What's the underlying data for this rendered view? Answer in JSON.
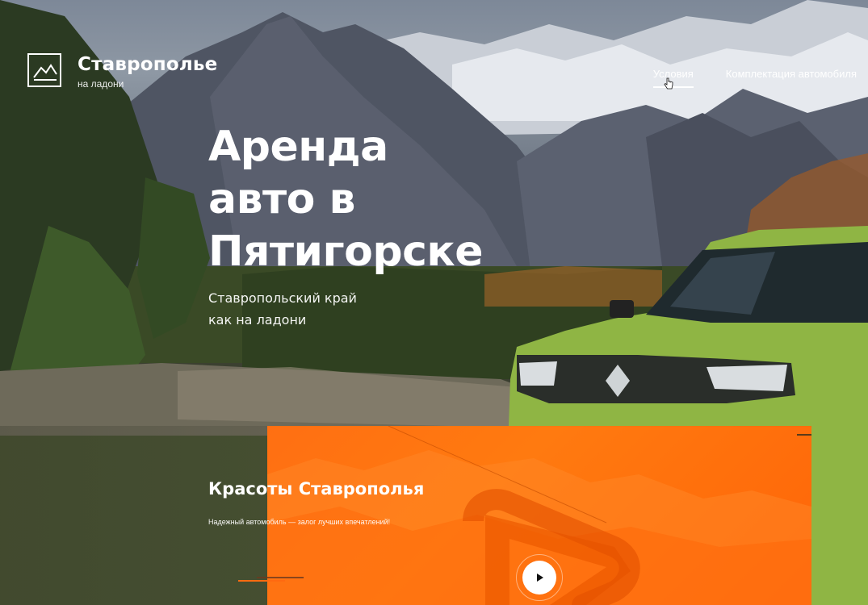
{
  "brand": {
    "title": "Ставрополье",
    "subtitle": "на ладони",
    "logo_icon": "mountain-icon"
  },
  "nav": {
    "items": [
      {
        "label": "Условия",
        "active": true
      },
      {
        "label": "Комплектация автомобиля",
        "active": false
      }
    ]
  },
  "hero": {
    "title_lines": [
      "Аренда",
      "авто в",
      "Пятигорске"
    ],
    "subtitle_lines": [
      "Ставропольский край",
      "как на ладони"
    ]
  },
  "promo": {
    "title": "Красоты Ставрополья",
    "text": "Надежный автомобиль — залог лучших впечатлений!",
    "play_icon": "play-icon"
  },
  "colors": {
    "accent": "#ff6f12",
    "text": "#ffffff",
    "car": "#8fb544"
  }
}
